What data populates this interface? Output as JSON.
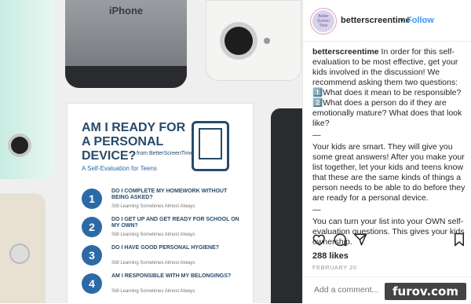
{
  "photo": {
    "iphone_brand": "iPhone",
    "card": {
      "title": "AM I READY FOR A PERSONAL DEVICE?",
      "from_label": "from BetterScreenTime",
      "subtitle": "A Self-Evaluation for Teens",
      "questions": [
        {
          "num": "1",
          "text": "DO I COMPLETE MY HOMEWORK WITHOUT BEING ASKED?"
        },
        {
          "num": "2",
          "text": "DO I GET UP AND GET READY FOR SCHOOL ON MY OWN?"
        },
        {
          "num": "3",
          "text": "DO I HAVE GOOD PERSONAL HYGIENE?"
        },
        {
          "num": "4",
          "text": "AM I RESPONSIBLE WITH MY BELONGINGS?"
        }
      ],
      "scale": "Still Learning    Sometimes    Almost Always"
    }
  },
  "post": {
    "avatar_text": "Better Screen Time",
    "username": "betterscreentime",
    "dot": "•",
    "follow_label": "Follow",
    "caption": {
      "username": "betterscreentime",
      "p1": " In order for this self-evaluation to be most effective, get your kids involved in the discussion! We recommend asking them two questions: 1️⃣What does it mean to be responsible? 2️⃣What does a person do if they are emotionally mature? What does that look like?",
      "rule1": "—",
      "p2": "Your kids are smart. They will give you some great answers! After you make your list together, let your kids and teens know that these are the same kinds of things a person needs to be able to do before they are ready for a personal device.",
      "rule2": "—",
      "p3": "You can turn your list into your OWN self-evaluation questions. This gives your kids ownership."
    },
    "likes": "288 likes",
    "date": "FEBRUARY 20",
    "comment_placeholder": "Add a comment..."
  },
  "watermark": "furov.com",
  "icons": [
    "heart-icon",
    "comment-icon",
    "share-icon",
    "bookmark-icon"
  ],
  "colors": {
    "follow": "#3897f0",
    "card_blue": "#2c6aa6",
    "card_navy": "#274b6b"
  }
}
